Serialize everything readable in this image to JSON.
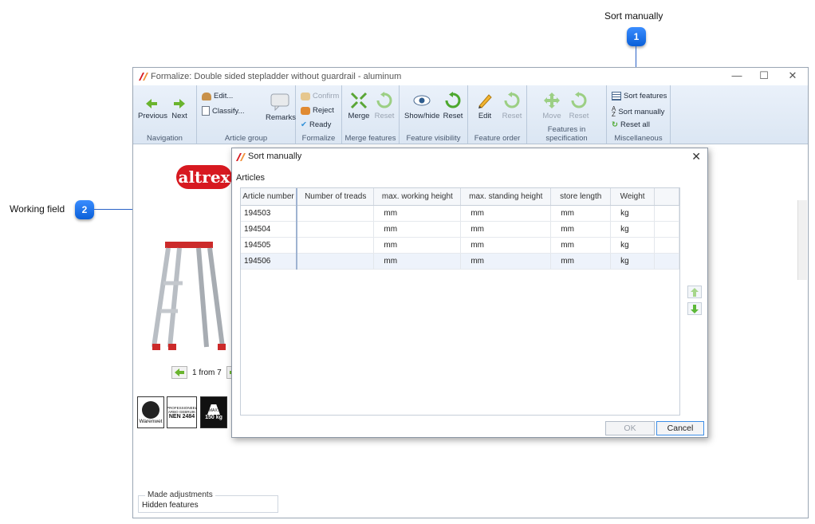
{
  "callouts": [
    {
      "number": "1",
      "label": "Sort manually"
    },
    {
      "number": "2",
      "label": "Working field"
    }
  ],
  "window": {
    "title": "Formalize: Double sided stepladder without guardrail - aluminum",
    "controls": {
      "minimize": "—",
      "maximize": "☐",
      "close": "✕"
    }
  },
  "ribbon": {
    "navigation": {
      "label": "Navigation",
      "previous": "Previous",
      "next": "Next"
    },
    "article_group": {
      "label": "Article group",
      "edit": "Edit...",
      "classify": "Classify...",
      "remarks": "Remarks"
    },
    "formalize": {
      "label": "Formalize",
      "confirm": "Confirm",
      "reject": "Reject",
      "ready": "Ready"
    },
    "merge_features": {
      "label": "Merge features",
      "merge": "Merge",
      "reset": "Reset"
    },
    "feature_visibility": {
      "label": "Feature visibility",
      "show_hide": "Show/hide",
      "reset": "Reset"
    },
    "feature_order": {
      "label": "Feature order",
      "edit": "Edit",
      "reset": "Reset"
    },
    "features_in_spec": {
      "label": "Features in specification",
      "move": "Move",
      "reset": "Reset"
    },
    "miscellaneous": {
      "label": "Miscellaneous",
      "sort_features": "Sort features",
      "sort_manually": "Sort manually",
      "reset_all": "Reset all"
    }
  },
  "content": {
    "logo_text": "altrex",
    "pager_text": "1 from 7",
    "badges": [
      "Warenwet",
      "PROFESSIONEEL ARBO GEBRUIK",
      "NEN 2484",
      "MAX.",
      "150 kg"
    ],
    "made_adjustments": {
      "legend": "Made adjustments",
      "text": "Hidden features"
    }
  },
  "dialog": {
    "title": "Sort manually",
    "section_label": "Articles",
    "columns": [
      "Article number",
      "Number of treads",
      "max. working height",
      "max. standing height",
      "store length",
      "Weight"
    ],
    "rows": [
      {
        "article": "194503",
        "treads": "",
        "working": "mm",
        "standing": "mm",
        "store": "mm",
        "weight": "kg"
      },
      {
        "article": "194504",
        "treads": "",
        "working": "mm",
        "standing": "mm",
        "store": "mm",
        "weight": "kg"
      },
      {
        "article": "194505",
        "treads": "",
        "working": "mm",
        "standing": "mm",
        "store": "mm",
        "weight": "kg"
      },
      {
        "article": "194506",
        "treads": "",
        "working": "mm",
        "standing": "mm",
        "store": "mm",
        "weight": "kg"
      }
    ],
    "selected_row_index": 3,
    "ok_label": "OK",
    "cancel_label": "Cancel"
  },
  "colors": {
    "accent": "#0a5fd8",
    "ribbon": "#dbe6f3",
    "brand_red": "#d71920",
    "green_arrow": "#6ab42e"
  }
}
